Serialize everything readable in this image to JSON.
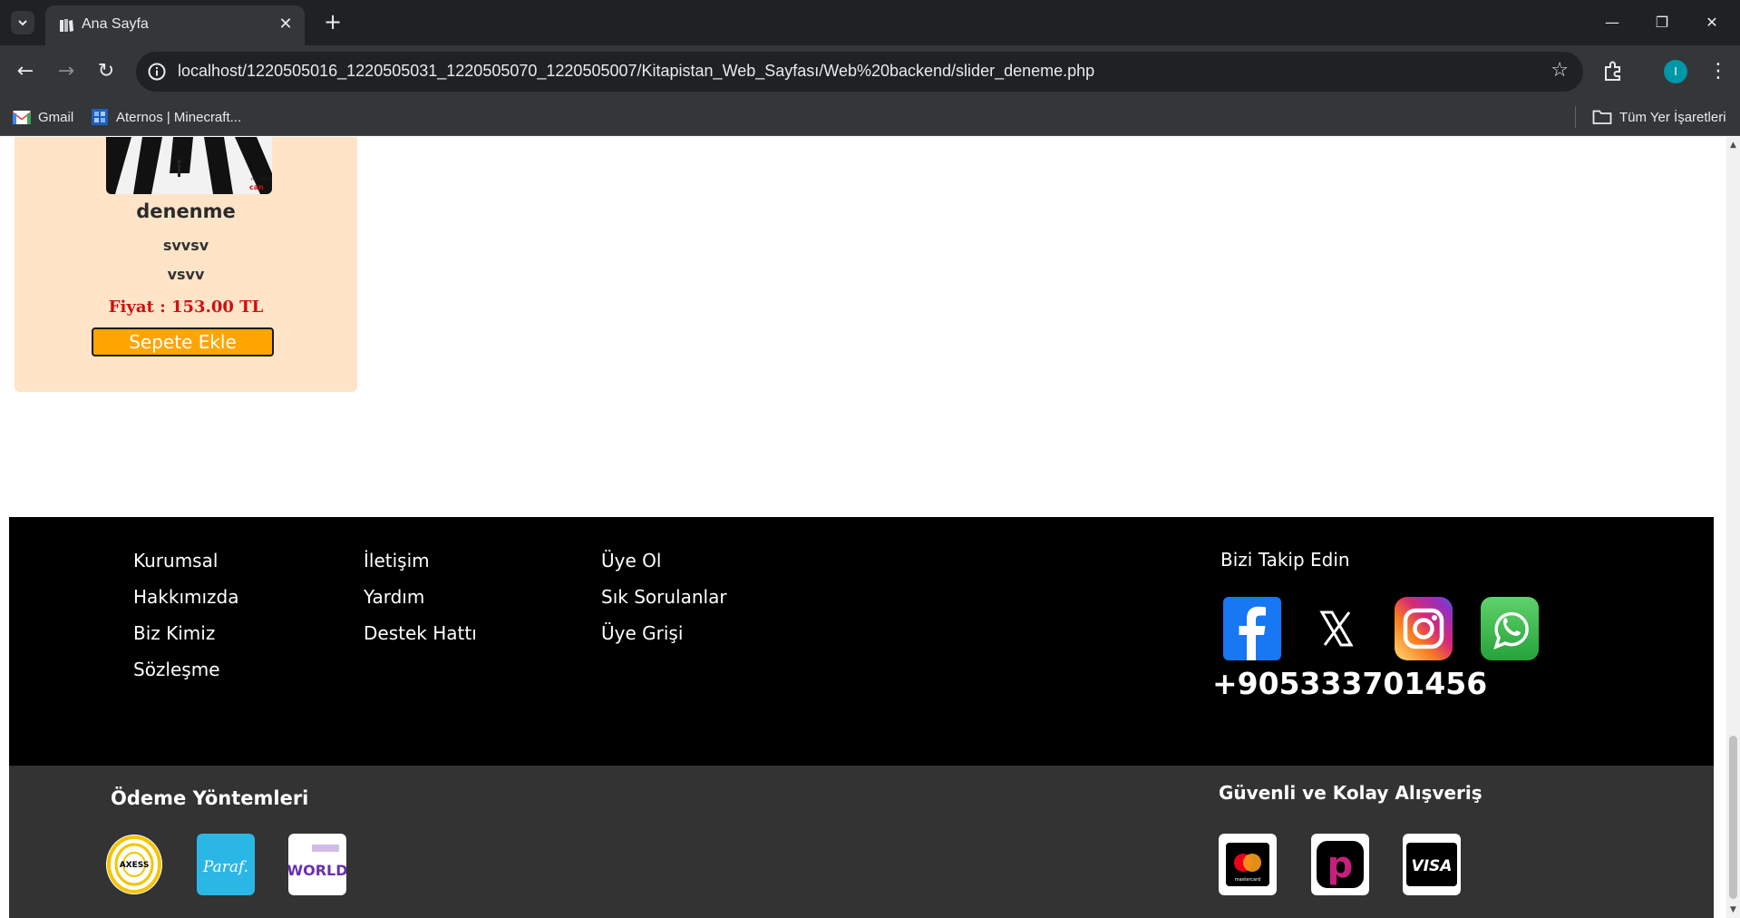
{
  "browser": {
    "tab_title": "Ana Sayfa",
    "new_tab_symbol": "+",
    "tab_close_symbol": "✕",
    "url": "localhost/1220505016_1220505031_1220505070_1220505007/Kitapistan_Web_Sayfası/Web%20backend/slider_deneme.php",
    "profile_initial": "I",
    "bookmarks": [
      {
        "label": "Gmail",
        "icon": "gmail-icon"
      },
      {
        "label": "Aternos | Minecraft...",
        "icon": "aternos-icon"
      }
    ],
    "all_bookmarks_label": "Tüm Yer İşaretleri"
  },
  "product": {
    "title": "denenme",
    "author": "svvsv",
    "publisher": "vsvv",
    "price_text": "Fiyat : 153.00 TL",
    "add_to_cart_label": "Sepete Ekle",
    "image_caption": "can"
  },
  "footer": {
    "col1": [
      "Kurumsal",
      "Hakkımızda",
      "Biz Kimiz",
      "Sözleşme"
    ],
    "col2": [
      "İletişim",
      "Yardım",
      "Destek Hattı"
    ],
    "col3": [
      "Üye Ol",
      "Sık Sorulanlar",
      "Üye Grişi"
    ],
    "follow_title": "Bizi Takip Edin",
    "social": [
      "facebook-icon",
      "x-icon",
      "instagram-icon",
      "whatsapp-icon"
    ],
    "phone": "+905333701456",
    "payment_title": "Ödeme Yöntemleri",
    "payment_methods": [
      {
        "name": "axess-icon",
        "label": "AXESS"
      },
      {
        "name": "paraf-icon",
        "label": "Paraf."
      },
      {
        "name": "world-icon",
        "label": "WORLD"
      }
    ],
    "secure_title": "Güvenli ve Kolay Alışveriş",
    "secure_methods": [
      {
        "name": "mastercard-icon",
        "label": "mastercard"
      },
      {
        "name": "papara-icon",
        "label": "p"
      },
      {
        "name": "visa-icon",
        "label": "VISA"
      }
    ]
  },
  "colors": {
    "card_bg": "#ffe4c8",
    "price": "#d01010",
    "button": "#ffa500",
    "footer_top": "#000000",
    "footer_bottom": "#333333"
  }
}
